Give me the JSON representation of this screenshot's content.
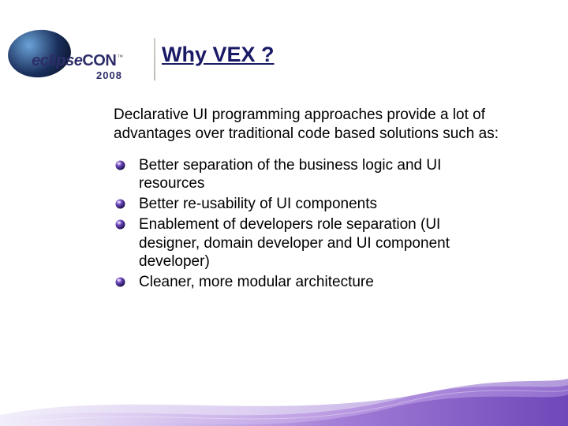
{
  "header": {
    "brand_eclipse": "eclipse",
    "brand_con": "CON",
    "brand_tm": "™",
    "year": "2008"
  },
  "title": "Why VEX ?",
  "intro": "Declarative UI programming approaches provide a lot of advantages over traditional code based solutions such as:",
  "bullets": [
    "Better separation of the business logic and UI resources",
    "Better re-usability of UI components",
    "Enablement of developers role separation (UI designer, domain developer and UI component developer)",
    "Cleaner, more modular architecture"
  ]
}
